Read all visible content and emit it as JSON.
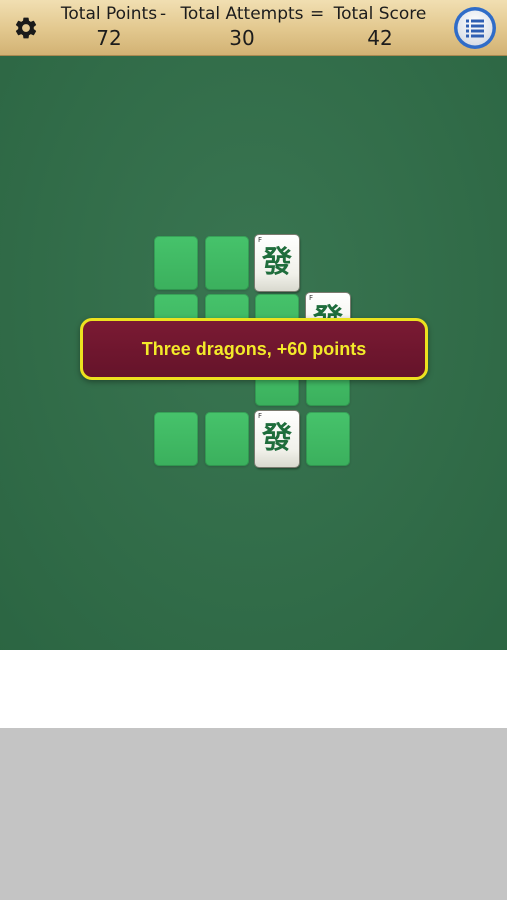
{
  "scorebar": {
    "points_label": "Total Points",
    "attempts_label": "Total Attempts",
    "score_label": "Total Score",
    "separator_minus": "-",
    "separator_equals": "=",
    "points_value": "72",
    "attempts_value": "30",
    "score_value": "42",
    "gear_icon": "gear-icon",
    "menu_icon": "list-menu-icon"
  },
  "board": {
    "felt_color": "#2f6e48",
    "slot_color": "#42bb66",
    "tiles": [
      {
        "glyph": "發",
        "corner": "F",
        "name": "green-dragon"
      },
      {
        "glyph": "發",
        "corner": "F",
        "name": "green-dragon"
      },
      {
        "glyph": "發",
        "corner": "F",
        "name": "green-dragon"
      }
    ]
  },
  "banner": {
    "message": "Three dragons, +60 points",
    "text_color": "#f3ea2a",
    "bg_color": "#6e1730",
    "border_color": "#ece21f"
  }
}
